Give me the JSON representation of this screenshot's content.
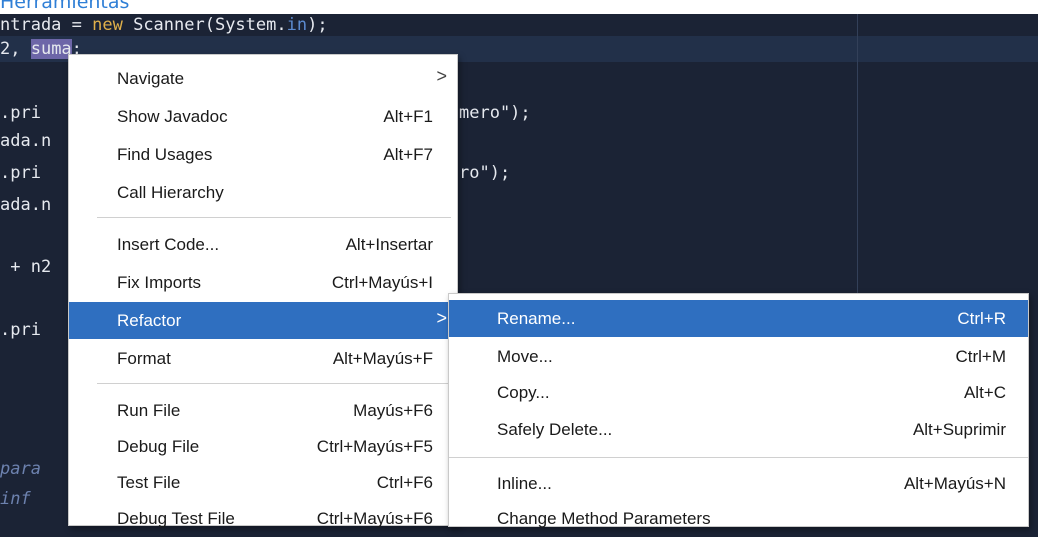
{
  "window": {
    "title_fragment": "Herramientas"
  },
  "editor": {
    "lines": [
      {
        "pre": "ntrada = ",
        "kw": "new",
        "mid": " Scanner(System.",
        "sy": "in",
        "post": ");"
      },
      {
        "pre": "2, ",
        "sel": "suma",
        "post": ";"
      },
      {
        "text": ".pri"
      },
      {
        "text": "ada.n"
      },
      {
        "text": ".pri"
      },
      {
        "text": "ada.n"
      },
      {
        "text": " + n2"
      },
      {
        "text": ".pri"
      },
      {
        "comment": "para"
      },
      {
        "comment": "inf"
      }
    ],
    "behind_fragments": [
      {
        "text": "mero\");"
      },
      {
        "text": "ro\");"
      }
    ]
  },
  "context_menu": {
    "items": [
      {
        "label": "Navigate",
        "shortcut": "",
        "submenu": true
      },
      {
        "label": "Show Javadoc",
        "shortcut": "Alt+F1"
      },
      {
        "label": "Find Usages",
        "shortcut": "Alt+F7"
      },
      {
        "label": "Call Hierarchy",
        "shortcut": ""
      },
      {
        "label": "Insert Code...",
        "shortcut": "Alt+Insertar"
      },
      {
        "label": "Fix Imports",
        "shortcut": "Ctrl+Mayús+I"
      },
      {
        "label": "Refactor",
        "shortcut": "",
        "submenu": true,
        "active": true
      },
      {
        "label": "Format",
        "shortcut": "Alt+Mayús+F"
      },
      {
        "label": "Run File",
        "shortcut": "Mayús+F6"
      },
      {
        "label": "Debug File",
        "shortcut": "Ctrl+Mayús+F5"
      },
      {
        "label": "Test File",
        "shortcut": "Ctrl+F6"
      },
      {
        "label": "Debug Test File",
        "shortcut": "Ctrl+Mayús+F6"
      }
    ],
    "submenu_arrow": ">"
  },
  "refactor_submenu": {
    "items": [
      {
        "label": "Rename...",
        "shortcut": "Ctrl+R",
        "active": true
      },
      {
        "label": "Move...",
        "shortcut": "Ctrl+M"
      },
      {
        "label": "Copy...",
        "shortcut": "Alt+C"
      },
      {
        "label": "Safely Delete...",
        "shortcut": "Alt+Suprimir"
      },
      {
        "label": "Inline...",
        "shortcut": "Alt+Mayús+N"
      },
      {
        "label": "Change Method Parameters",
        "shortcut": ""
      }
    ]
  },
  "colors": {
    "editor_bg": "#1b2335",
    "menu_bg": "#ffffff",
    "menu_highlight": "#2f6fc0",
    "keyword": "#e0b04a",
    "selection": "#6d66a8"
  }
}
